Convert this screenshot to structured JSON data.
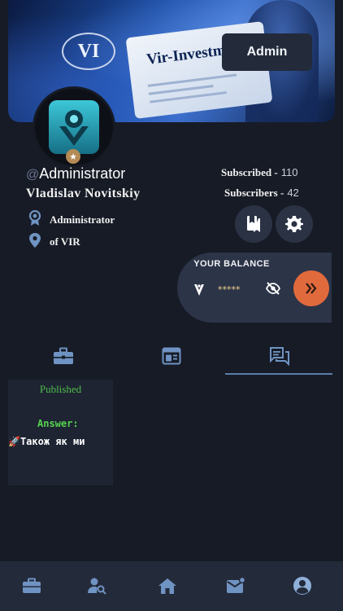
{
  "banner": {
    "logo_text": "VI",
    "brand_text": "Vir-Investments",
    "admin_button": "Admin"
  },
  "profile": {
    "handle_prefix": "@",
    "handle": "Administrator",
    "full_name": "Vladislav  Novitskiy",
    "role": "Administrator",
    "location": "of VIR",
    "subscribed_label": "Subscribed -",
    "subscribed_count": "110",
    "subscribers_label": "Subscribers -",
    "subscribers_count": "42"
  },
  "balance": {
    "title": "YOUR BALANCE",
    "masked_value": "*****"
  },
  "tabs": [
    {
      "icon": "briefcase-icon"
    },
    {
      "icon": "dashboard-icon"
    },
    {
      "icon": "forum-icon",
      "active": true
    }
  ],
  "post": {
    "status": "Published",
    "answer_label": "Answer:",
    "text": "🚀Також як ми"
  },
  "bottom_nav": [
    {
      "icon": "briefcase-icon"
    },
    {
      "icon": "person-search-icon"
    },
    {
      "icon": "home-icon"
    },
    {
      "icon": "mail-icon"
    },
    {
      "icon": "account-icon",
      "active": true
    }
  ],
  "colors": {
    "background": "#171b26",
    "card": "#2c3447",
    "accent": "#e16a3d",
    "published": "#4fbe4a",
    "icon": "#6f93c2"
  }
}
